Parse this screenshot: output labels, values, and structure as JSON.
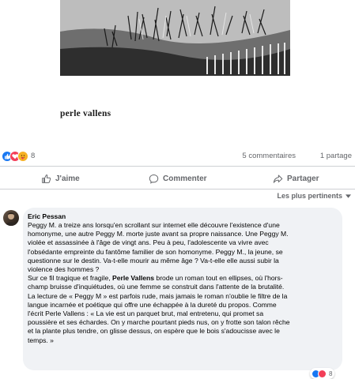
{
  "post": {
    "cover": {
      "author_name": "perle vallens",
      "image_alt": "dunes-with-grass-and-fence-photo"
    },
    "reactions": {
      "icons": [
        "like-icon",
        "love-icon",
        "care-icon"
      ],
      "count": "8",
      "comments": "5 commentaires",
      "shares": "1 partage"
    },
    "actions": {
      "like": "J'aime",
      "comment": "Commenter",
      "share": "Partager"
    },
    "sort_label": "Les plus pertinents"
  },
  "comment": {
    "author": "Eric Pessan",
    "lines": [
      "Peggy M. a treize ans lorsqu'en scrollant sur internet elle découvre l'existence d'une",
      "homonyme, une autre Peggy M. morte juste avant sa propre naissance. Une Peggy M.",
      "violée et assassinée à l'âge de vingt ans. Peu à peu, l'adolescente va vivre avec",
      "l'obsédante empreinte du fantôme familier de son homonyme. Peggy M., la jeune, se",
      "questionne sur le destin. Va-t-elle mourir au même âge ? Va-t-elle elle aussi subir la",
      "violence des hommes ?"
    ],
    "para2_before": "Sur ce fil tragique et fragile, ",
    "para2_bold": "Perle Vallens",
    "para2_lines": [
      " brode un roman tout en ellipses, où l'hors-",
      "champ bruisse d'inquiétudes, où une femme se construit dans l'attente de la brutalité.",
      "La lecture de « Peggy M » est parfois rude, mais jamais le roman n'oublie le filtre de la",
      "langue incarnée et poétique qui offre une échappée à la dureté du propos. Comme",
      "l'écrit Perle Vallens : « La vie est un parquet brut, mal entretenu, qui promet sa",
      "poussière et ses échardes. On y marche pourtant pieds nus, on y frotte son talon rêche",
      "et la plante plus tendre, on glisse dessus, on espère que le bois s'adoucisse avec le",
      "temps. »"
    ],
    "reaction_count": "8",
    "reaction_icons": [
      "like-icon",
      "love-icon"
    ]
  },
  "colors": {
    "like_blue": "#1877f2",
    "love_red": "#f33e58",
    "care_yellow": "#f7b125",
    "secondary_text": "#65676b",
    "bubble_bg": "#f0f2f5"
  }
}
